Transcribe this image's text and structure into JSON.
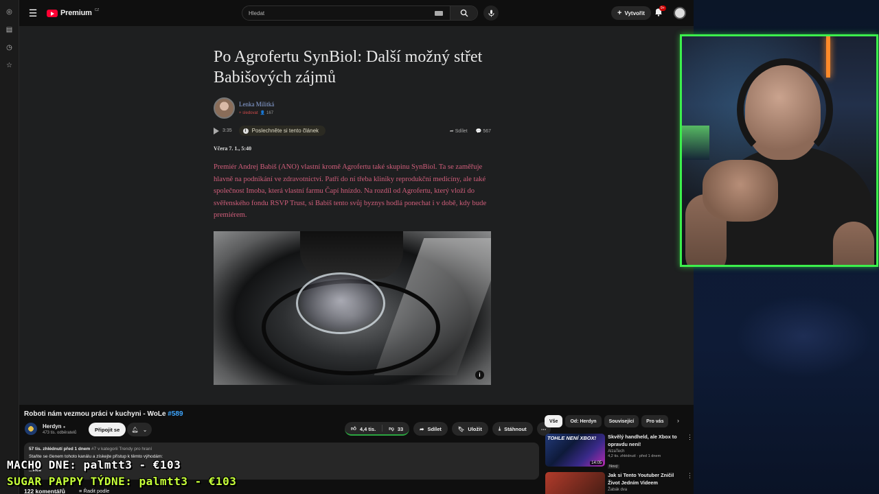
{
  "topbar": {
    "brand": "Premium",
    "region": "CZ",
    "search_placeholder": "Hledat",
    "create_label": "Vytvořit",
    "notifications_badge": "9+"
  },
  "article": {
    "title": "Po Agrofertu SynBiol: Další možný střet Babišových zájmů",
    "author": "Lenka Militká",
    "follow": "+ sledovat",
    "followers": "167",
    "duration": "3:35",
    "listen_label": "Poslechněte si tento článek",
    "share_label": "Sdílet",
    "comments_count": "567",
    "date": "Včera 7. 1., 5:40",
    "lead": "Premiér Andrej Babiš (ANO) vlastní kromě Agrofertu také skupinu SynBiol. Ta se zaměřuje hlavně na podnikání ve zdravotnictví. Patří do ní třeba kliniky reprodukční medicíny, ale také společnost Imoba, která vlastní farmu Čapí hnízdo. Na rozdíl od Agrofertu, který vloží do svěřenského fondu RSVP Trust, si Babiš tento svůj byznys hodlá ponechat i v době, kdy bude premiérem."
  },
  "video": {
    "title": "Roboti nám vezmou práci v kuchyni - WoLe",
    "tag": "#589",
    "channel": "Herdyn",
    "subscribers": "473 tis. odběratelů",
    "join_label": "Připojit se",
    "likes": "4,4 tis.",
    "dislikes": "33",
    "share_label": "Sdílet",
    "save_label": "Uložit",
    "download_label": "Stáhnout",
    "views": "57 tis. zhlédnutí",
    "age": "před 1 dnem",
    "category": "#7 v kategorii Trendy pro hraní",
    "desc_line": "Staňte se členem tohoto kanálu a získejte přístup k těmto výhodám:",
    "more": "...více",
    "comments": "122 komentářů",
    "sort": "Řadit podle"
  },
  "chips": [
    "Vše",
    "Od: Herdyn",
    "Související",
    "Pro vás"
  ],
  "related": [
    {
      "thumb_text": "TOHLE NENÍ XBOX!",
      "title": "Skvělý handheld, ale Xbox to opravdu není!",
      "channel": "AlzaTech",
      "stats": "4,2 tis. zhlédnutí · před 1 dnem",
      "badge": "Nový",
      "duration": "14:05"
    },
    {
      "thumb_text": "",
      "title": "Jak si Tento Youtuber Zničil Život Jedním Videem",
      "channel": "Žabák dva",
      "stats": "",
      "badge": "",
      "duration": ""
    }
  ],
  "overlay": {
    "line1": "MACHO DNE: palmtt3 - €103",
    "line2": "SUGAR PAPPY TÝDNE: palmtt3 - €103"
  },
  "colors": {
    "accent_green": "#3cf04c",
    "yt_red": "#ff0033",
    "lead_pink": "#d15e7b",
    "link_blue": "#3ea6ff"
  }
}
